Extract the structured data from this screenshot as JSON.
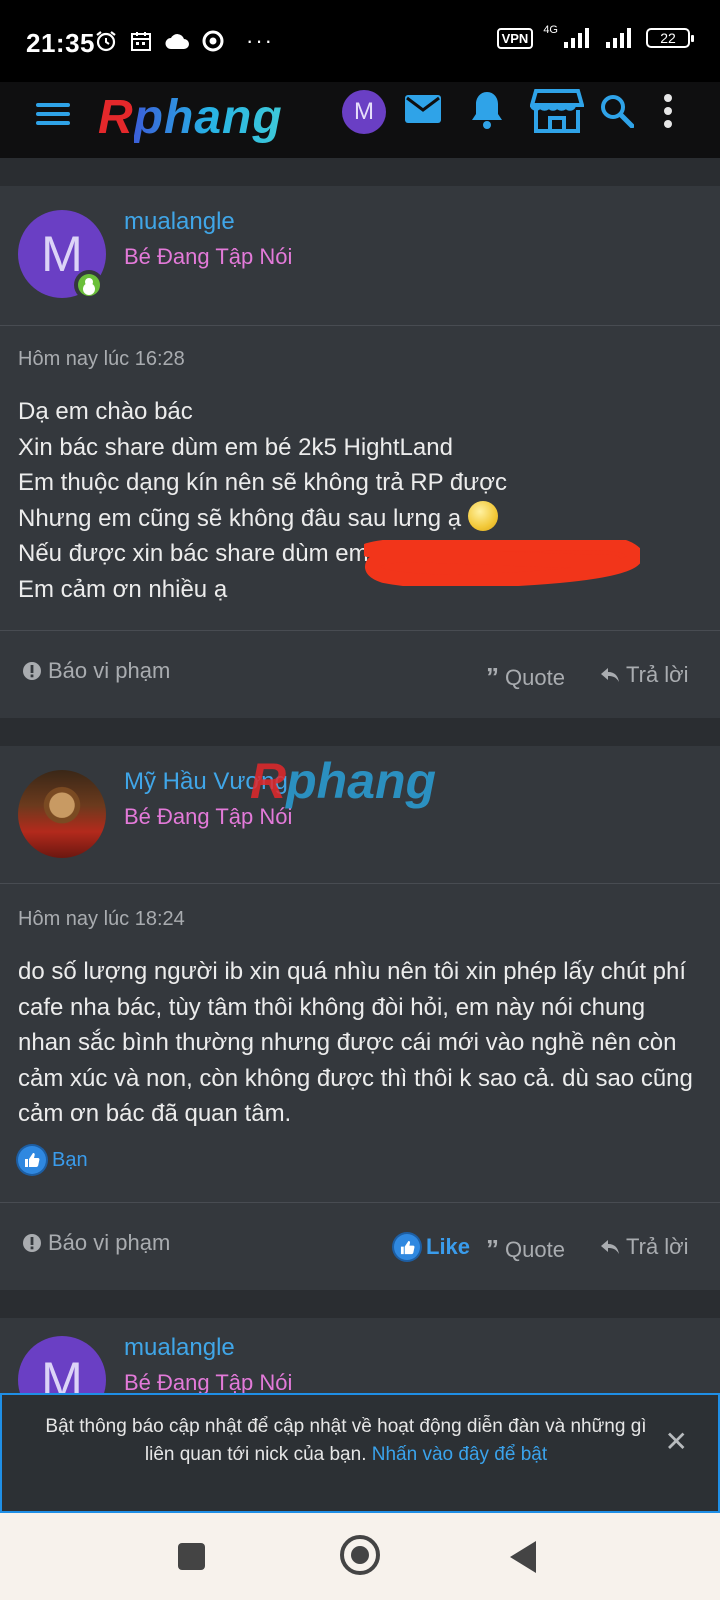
{
  "status_bar": {
    "time": "21:35",
    "more": "···",
    "vpn": "VPN",
    "network": "4G",
    "battery": "22"
  },
  "app_bar": {
    "logo_r": "R",
    "logo_rest": "phang",
    "avatar_letter": "M"
  },
  "watermark": {
    "r": "R",
    "rest": "phang"
  },
  "posts": [
    {
      "avatar_letter": "M",
      "username": "mualangle",
      "user_title": "Bé Đang Tập Nói",
      "timestamp": "Hôm nay lúc 16:28",
      "lines": [
        "Dạ em chào bác",
        "Xin bác share dùm em bé 2k5 HightLand",
        "Em thuộc dạng kín nên sẽ không trả RP được",
        "Nhưng em cũng sẽ không đâu sau lưng ạ",
        "Nếu được xin bác share dùm em",
        "Em cảm ơn nhiều ạ"
      ],
      "report": "Báo vi phạm",
      "quote": "Quote",
      "reply": "Trả lời"
    },
    {
      "username": "Mỹ Hầu Vương",
      "user_title": "Bé Đang Tập Nói",
      "timestamp": "Hôm nay lúc 18:24",
      "content": "do số lượng người ib xin quá nhìu nên tôi xin phép lấy chút phí cafe nha bác, tùy tâm thôi không đòi hỏi, em này nói chung nhan sắc bình thường nhưng được cái mới vào nghề nên còn cảm xúc và non, còn không được thì thôi k sao cả. dù sao cũng cảm ơn bác đã quan tâm.",
      "reaction_user": "Bạn",
      "report": "Báo vi phạm",
      "like": "Like",
      "quote": "Quote",
      "reply": "Trả lời"
    },
    {
      "avatar_letter": "M",
      "username": "mualangle",
      "user_title": "Bé Đang Tập Nói"
    }
  ],
  "notification": {
    "text": "Bật thông báo cập nhật để cập nhật về hoạt động diễn đàn và những gì liên quan tới nick của bạn.",
    "link": "Nhấn vào đây để bật"
  },
  "colors": {
    "accent": "#40a6e8",
    "user_title": "#e37ad9",
    "online": "#6bbf3a",
    "background": "#2a2d31",
    "post_bg": "#34383d"
  },
  "icons": [
    "alarm-icon",
    "calendar-icon",
    "cloud-icon",
    "chrome-icon",
    "signal-icon",
    "menu-icon",
    "mail-icon",
    "bell-icon",
    "store-icon",
    "search-icon",
    "kebab-icon",
    "alert-icon",
    "quote-icon",
    "reply-icon",
    "like-icon",
    "close-icon"
  ]
}
